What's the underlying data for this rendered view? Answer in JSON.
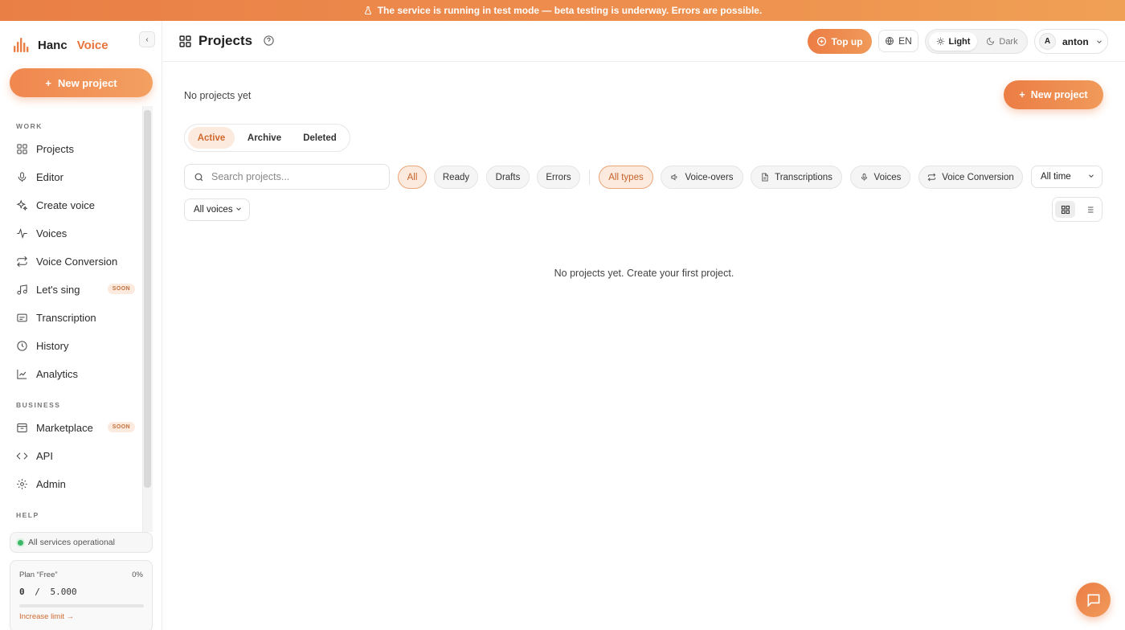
{
  "banner": {
    "text": "The service is running in test mode — beta testing is underway. Errors are possible."
  },
  "brand": {
    "name": "Hanc",
    "product": "Voice",
    "accent": "#e97f45"
  },
  "sidebar": {
    "new_project_label": "New project",
    "sections": {
      "work": "WORK",
      "business": "BUSINESS",
      "help": "HELP"
    },
    "items": [
      {
        "label": "Projects",
        "icon": "grid-icon"
      },
      {
        "label": "Editor",
        "icon": "mic-icon"
      },
      {
        "label": "Create voice",
        "icon": "sparkle-icon"
      },
      {
        "label": "Voices",
        "icon": "waveform-icon"
      },
      {
        "label": "Voice Conversion",
        "icon": "repeat-icon"
      },
      {
        "label": "Let's sing",
        "icon": "music-icon",
        "badge": "SOON"
      },
      {
        "label": "Transcription",
        "icon": "subtitles-icon"
      },
      {
        "label": "History",
        "icon": "clock-icon"
      },
      {
        "label": "Analytics",
        "icon": "chart-line-icon"
      },
      {
        "label": "Marketplace",
        "icon": "box-icon",
        "badge": "SOON"
      },
      {
        "label": "API",
        "icon": "code-icon"
      },
      {
        "label": "Admin",
        "icon": "gear-icon"
      }
    ],
    "status": "All services operational",
    "plan": {
      "name": "Plan “Free”",
      "percent": "0%",
      "used": "0",
      "separator": "/",
      "limit": "5.000",
      "usage_fraction": 0,
      "increase_link": "Increase limit →"
    }
  },
  "topbar": {
    "title": "Projects",
    "top_up": "Top up",
    "language": "EN",
    "theme": {
      "light": "Light",
      "dark": "Dark",
      "selected": "Light"
    },
    "user": {
      "initial": "A",
      "name": "anton"
    }
  },
  "main": {
    "heading": "No projects yet",
    "new_project_label": "New project",
    "tabs": [
      {
        "label": "Active",
        "active": true
      },
      {
        "label": "Archive"
      },
      {
        "label": "Deleted"
      }
    ],
    "search": {
      "placeholder": "Search projects...",
      "value": ""
    },
    "status_filters": [
      {
        "label": "All",
        "active": true
      },
      {
        "label": "Ready"
      },
      {
        "label": "Drafts"
      },
      {
        "label": "Errors"
      }
    ],
    "type_filters": [
      {
        "label": "All types",
        "active": true
      },
      {
        "label": "Voice-overs",
        "icon": "speaker-icon"
      },
      {
        "label": "Transcriptions",
        "icon": "document-icon"
      },
      {
        "label": "Voices",
        "icon": "mic-icon"
      },
      {
        "label": "Voice Conversion",
        "icon": "repeat-icon"
      }
    ],
    "time_select": "All time",
    "voices_select": "All voices",
    "view_mode": "grid",
    "empty_message": "No projects yet. Create your first project."
  }
}
